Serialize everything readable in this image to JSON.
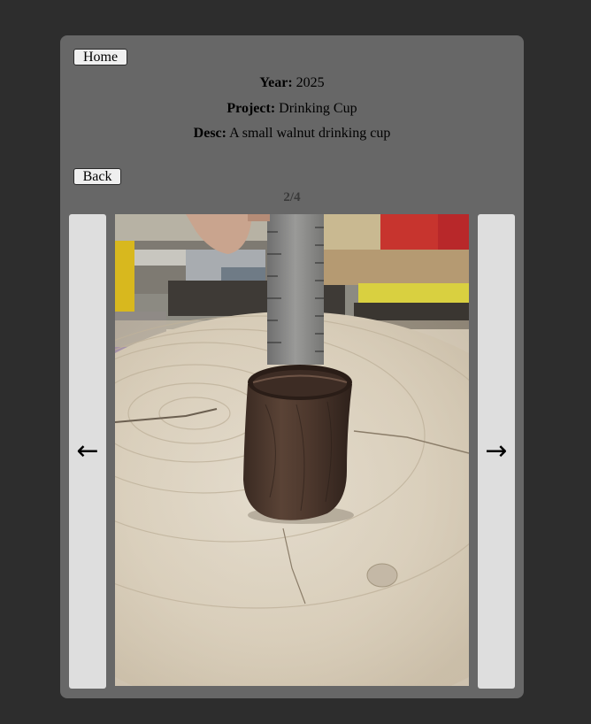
{
  "nav": {
    "home_label": "Home",
    "back_label": "Back"
  },
  "project": {
    "year_label": "Year:",
    "year": "2025",
    "project_label": "Project:",
    "project_name": "Drinking Cup",
    "desc_label": "Desc:",
    "desc": "A small walnut drinking cup"
  },
  "gallery": {
    "counter": "2/4",
    "prev_icon": "←",
    "next_icon": "→",
    "current_index": 2,
    "total_images": 4
  },
  "colors": {
    "page_background": "#2d2d2d",
    "card_background": "#676767",
    "button_background": "#efefef",
    "nav_button_background": "#dedede"
  }
}
